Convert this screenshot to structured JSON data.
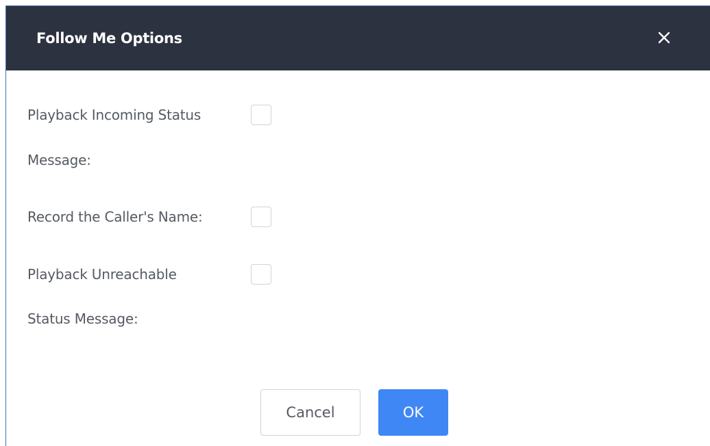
{
  "dialog": {
    "title": "Follow Me Options",
    "close_icon": "close-icon",
    "close_glyph": "✕"
  },
  "options": [
    {
      "label_line1": "Playback Incoming Status",
      "label_line2": "Message:",
      "checked": false
    },
    {
      "label_line1": "Record the Caller's Name:",
      "checked": false
    },
    {
      "label_line1": "Playback Unreachable",
      "label_line2": "Status Message:",
      "checked": false
    }
  ],
  "buttons": {
    "cancel_label": "Cancel",
    "ok_label": "OK"
  },
  "colors": {
    "header_bg": "#2d3240",
    "primary": "#3f87f5",
    "label_text": "#555a62",
    "border": "#cfd3da"
  }
}
